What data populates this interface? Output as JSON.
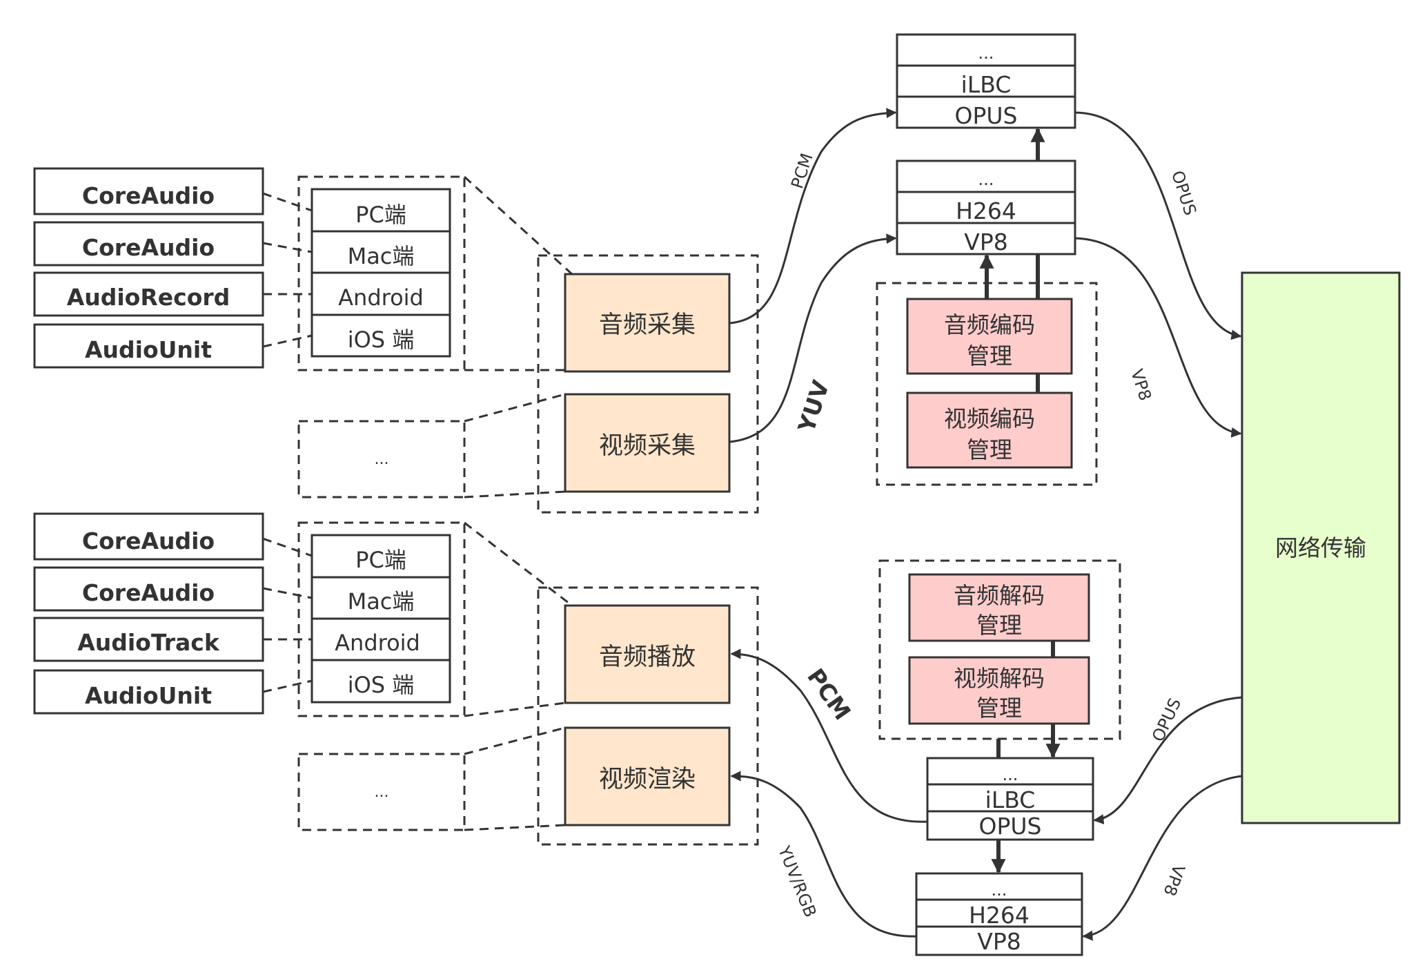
{
  "colors": {
    "stroke": "#333333",
    "capture_fill": "#ffe6cc",
    "codec_fill": "#ffcccc",
    "network_fill": "#e6ffcc"
  },
  "capture": {
    "apis": [
      "CoreAudio",
      "CoreAudio",
      "AudioRecord",
      "AudioUnit"
    ],
    "platforms": [
      "PC端",
      "Mac端",
      "Android",
      "iOS 端"
    ],
    "ellipsis": "...",
    "audio": "音频采集",
    "video": "视频采集"
  },
  "playback": {
    "apis": [
      "CoreAudio",
      "CoreAudio",
      "AudioTrack",
      "AudioUnit"
    ],
    "platforms": [
      "PC端",
      "Mac端",
      "Android",
      "iOS 端"
    ],
    "ellipsis": "...",
    "audio": "音频播放",
    "video": "视频渲染"
  },
  "encode": {
    "audio_codecs": [
      "...",
      "iLBC",
      "OPUS"
    ],
    "video_codecs": [
      "...",
      "H264",
      "VP8"
    ],
    "audio_mgr": [
      "音频编码",
      "管理"
    ],
    "video_mgr": [
      "视频编码",
      "管理"
    ]
  },
  "decode": {
    "audio_mgr": [
      "音频解码",
      "管理"
    ],
    "video_mgr": [
      "视频解码",
      "管理"
    ],
    "audio_codecs": [
      "...",
      "iLBC",
      "OPUS"
    ],
    "video_codecs": [
      "...",
      "H264",
      "VP8"
    ]
  },
  "network": "网络传输",
  "edges": {
    "pcm_in": "PCM",
    "yuv_in": "YUV",
    "opus_out": "OPUS",
    "vp8_out": "VP8",
    "opus_in": "OPUS",
    "vp8_in": "VP8",
    "pcm_out": "PCM",
    "yuv_rgb_out": "YUV/RGB"
  }
}
